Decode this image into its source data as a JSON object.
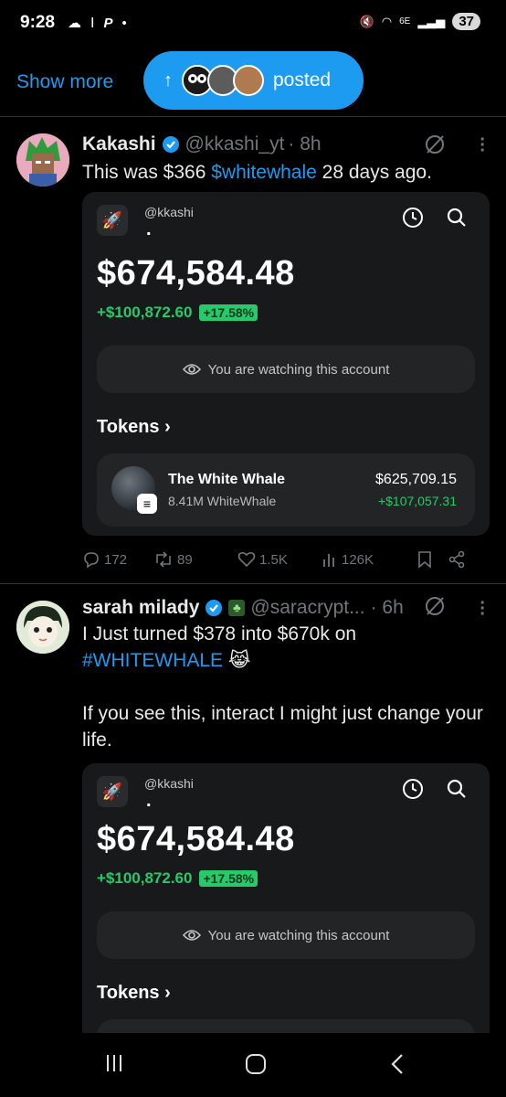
{
  "status_bar": {
    "time": "9:28",
    "network": "6E",
    "battery": "37"
  },
  "top": {
    "show_more": "Show more",
    "posted_label": "posted"
  },
  "tweets": [
    {
      "name": "Kakashi",
      "handle": "@kkashi_yt",
      "time": "· 8h",
      "text_pre": "This was $366 ",
      "text_link": "$whitewhale",
      "text_post": " 28 days ago.",
      "card": {
        "user": "@kkashi",
        "dot": ".",
        "balance": "$674,584.48",
        "pnl": "+$100,872.60",
        "pct": "+17.58%",
        "watching": "You are watching this account",
        "tokens_label": "Tokens",
        "token": {
          "name": "The White Whale",
          "amount": "8.41M WhiteWhale",
          "value": "$625,709.15",
          "change": "+$107,057.31"
        }
      },
      "actions": {
        "replies": "172",
        "reposts": "89",
        "likes": "1.5K",
        "views": "126K"
      }
    },
    {
      "name": "sarah milady",
      "handle": "@saracrypt...",
      "time": "· 6h",
      "text_line1": "I Just turned $378 into $670k on",
      "text_hashtag": "#WHITEWHALE",
      "text_emoji": "😹",
      "text_line3": "If you see this, interact I might just change your life.",
      "card": {
        "user": "@kkashi",
        "dot": ".",
        "balance": "$674,584.48",
        "pnl": "+$100,872.60",
        "pct": "+17.58%",
        "watching": "You are watching this account",
        "tokens_label": "Tokens"
      }
    }
  ],
  "colors": {
    "accent": "#1d9bf0",
    "positive": "#27c96b",
    "background": "#000000",
    "card": "#18191a"
  }
}
